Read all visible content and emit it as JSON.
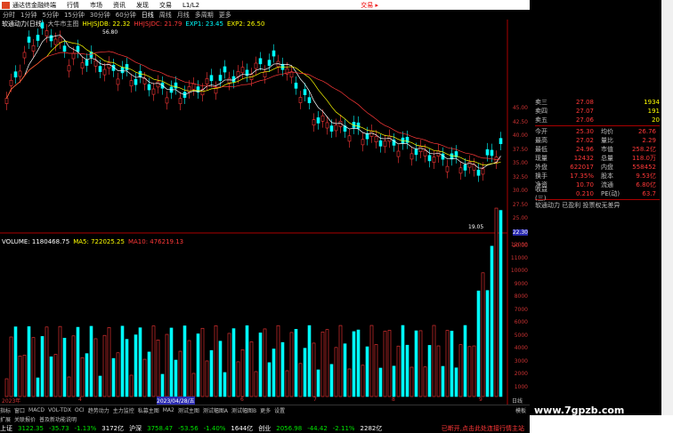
{
  "menubar": {
    "app_name": "通达信金融终端",
    "items": [
      "行情",
      "市场",
      "资讯",
      "发现",
      "交易",
      "L1/L2"
    ],
    "trade_label": "交易 ▸"
  },
  "periods": [
    "分时",
    "1分钟",
    "5分钟",
    "15分钟",
    "30分钟",
    "60分钟",
    "日线",
    "周线",
    "月线",
    "多周期",
    "更多"
  ],
  "active_period": "日线",
  "chart_header": {
    "stock_title": "软通动力(日线)",
    "indicator_name": "大牛市主图",
    "hhjsjdb": "HHJSJDB: 22.32",
    "hhjsjdc": "HHJSJDC: 21.79",
    "exp1": "EXP1: 23.45",
    "exp2": "EXP2: 26.50",
    "max_label": "56.80",
    "min_label": "19.05"
  },
  "price_axis": [
    "45.00",
    "42.50",
    "40.00",
    "37.50",
    "35.00",
    "32.50",
    "30.00",
    "27.50",
    "25.00",
    "22.30",
    "20.00"
  ],
  "volume_header": {
    "volume": "VOLUME: 1180468.75",
    "ma5": "MA5: 722025.25",
    "ma10": "MA10: 476219.13"
  },
  "volume_axis": [
    "12000",
    "11000",
    "10000",
    "9000",
    "8000",
    "7000",
    "6000",
    "5000",
    "4000",
    "3000",
    "2000",
    "1000"
  ],
  "volume_unit": "X10",
  "date_axis": [
    "2023年",
    "4",
    "2023/04/28/五",
    "6",
    "7",
    "8",
    "9",
    "日线"
  ],
  "indicator_tabs": [
    "指标",
    "窗口",
    "MACD",
    "VOL-TDX",
    "OCI",
    "趋势动力",
    "主力监控",
    "私募主图",
    "大单",
    "测试主图",
    "测试幅图A",
    "测试幅图B",
    "更多",
    "设置"
  ],
  "bottom_tabs": [
    "扩展",
    "关联报价",
    "普及新功能说明"
  ],
  "bottom_tabs2": [
    "MA2"
  ],
  "quotes": {
    "sell": [
      {
        "label": "卖三",
        "price": "27.08",
        "vol": "1934"
      },
      {
        "label": "卖四",
        "price": "27.07",
        "vol": "191"
      },
      {
        "label": "卖五",
        "price": "27.06",
        "vol": "20"
      }
    ],
    "stats": [
      {
        "l1": "今开",
        "v1": "25.30",
        "l2": "均价",
        "v2": "26.76"
      },
      {
        "l1": "最高",
        "v1": "27.02",
        "l2": "量比",
        "v2": "2.29"
      },
      {
        "l1": "最低",
        "v1": "24.96",
        "l2": "市值",
        "v2": "258.2亿"
      },
      {
        "l1": "现量",
        "v1": "12432",
        "l2": "总量",
        "v2": "118.0万"
      },
      {
        "l1": "外盘",
        "v1": "622017",
        "l2": "内盘",
        "v2": "558452"
      },
      {
        "l1": "换手",
        "v1": "17.35%",
        "l2": "股本",
        "v2": "9.53亿"
      },
      {
        "l1": "净资",
        "v1": "10.70",
        "l2": "流通",
        "v2": "6.80亿"
      },
      {
        "l1": "收益(三)",
        "v1": "0.210",
        "l2": "PE(动)",
        "v2": "63.7"
      }
    ],
    "status_line": "软通动力 已盈利 投票权无差异"
  },
  "status": {
    "sh_label": "上证",
    "sh_val": "3122.35",
    "sh_chg": "-35.73",
    "sh_pct": "-1.13%",
    "sh_amt": "3172亿",
    "hs_label": "沪深",
    "hs_val": "3758.47",
    "hs_chg": "-53.56",
    "hs_pct": "-1.40%",
    "hs_amt": "1644亿",
    "cy_label": "创业",
    "cy_val": "2056.98",
    "cy_chg": "-44.42",
    "cy_pct": "-2.11%",
    "cy_amt": "2282亿",
    "right": "已断开,点击此处连接行情主站"
  },
  "watermark": "www.7gpzb.com",
  "side_tab": "模板",
  "colors": {
    "up": "#ff3838",
    "down": "#00ffff",
    "ma1": "#ffffff",
    "ma2": "#ffff00",
    "ma3": "#ff00ff"
  }
}
